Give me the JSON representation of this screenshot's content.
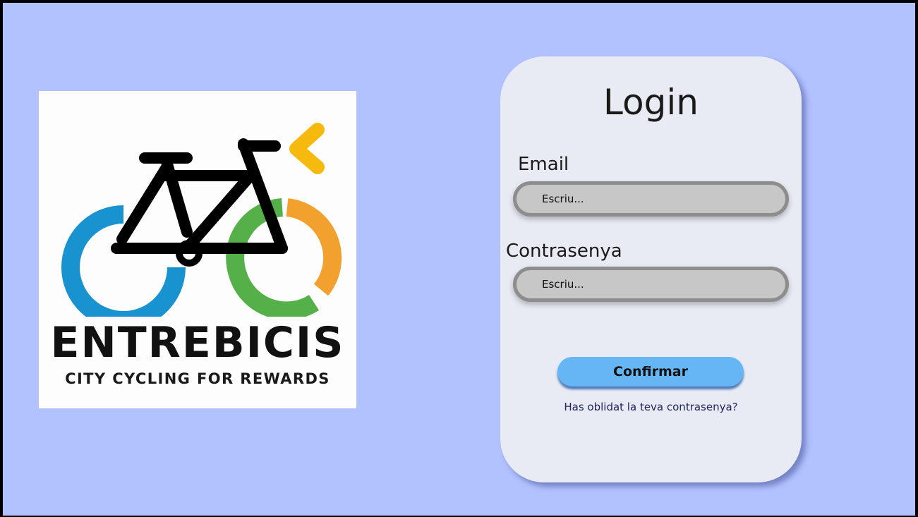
{
  "logo": {
    "icon": "bicycle-icon",
    "title": "ENTREBICIS",
    "tagline": "CITY CYCLING FOR REWARDS",
    "colors": {
      "rear_wheel": "#1993cf",
      "front_wheel_green": "#56b04a",
      "front_wheel_orange": "#f2a12e",
      "chevron": "#f6b90d",
      "frame": "#000000"
    }
  },
  "login": {
    "title": "Login",
    "email_label": "Email",
    "email_placeholder": "Escriu...",
    "password_label": "Contrasenya",
    "password_placeholder": "Escriu...",
    "confirm_label": "Confirmar",
    "forgot_label": "Has oblidat la teva contrasenya?"
  },
  "colors": {
    "background": "#b1c2ff",
    "card": "#e8ebf4",
    "button": "#66b6f6",
    "input": "#c7c7c7"
  }
}
